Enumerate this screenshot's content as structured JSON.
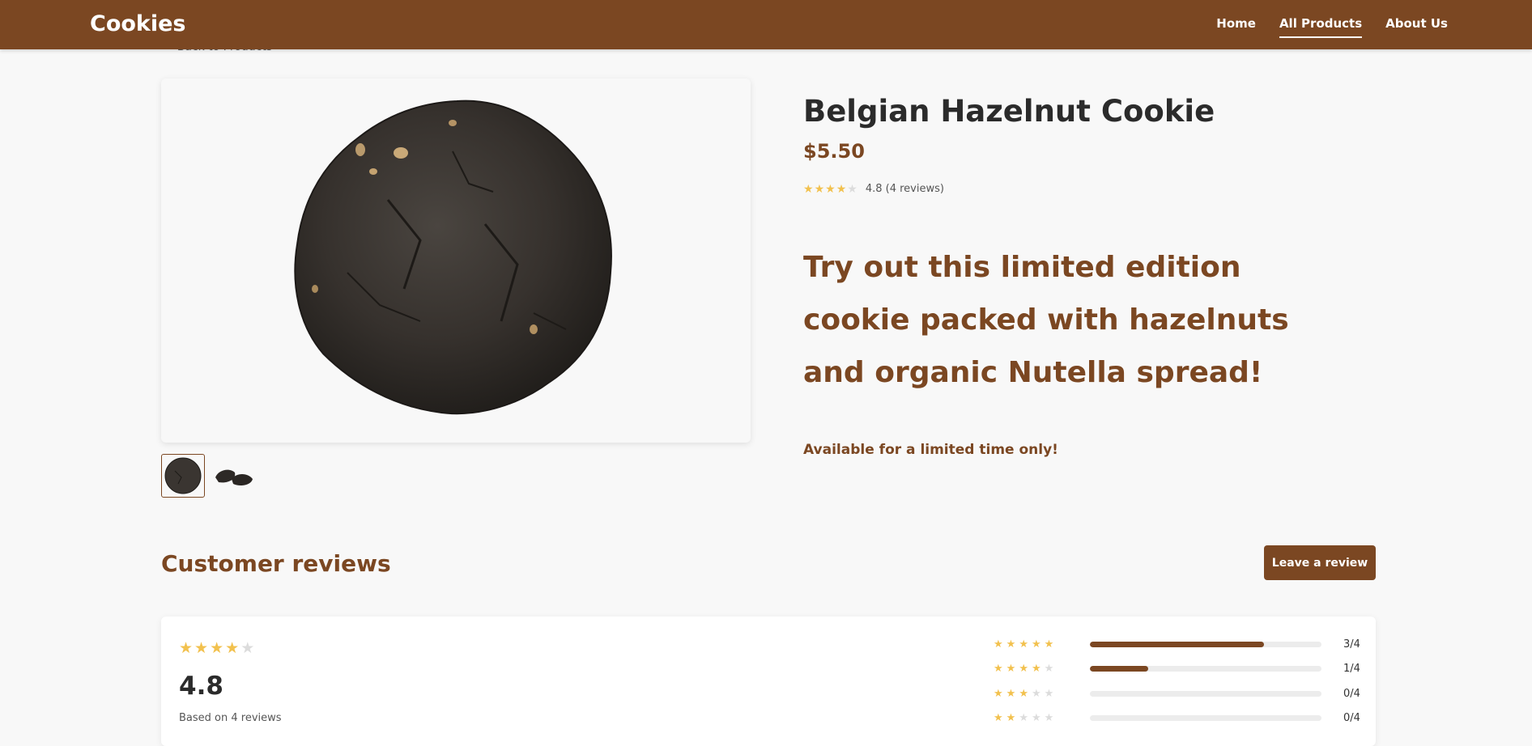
{
  "nav": {
    "brand": "Cookies",
    "links": [
      {
        "label": "Home",
        "active": false
      },
      {
        "label": "All Products",
        "active": true
      },
      {
        "label": "About Us",
        "active": false
      }
    ]
  },
  "back_link": {
    "label": "Back to Products",
    "icon": "arrow-left-icon"
  },
  "product": {
    "title": "Belgian Hazelnut Cookie",
    "price": "$5.50",
    "rating": 4.8,
    "rating_text": "4.8 (4 reviews)",
    "headline": "Try out this limited edition cookie packed with hazelnuts and organic Nutella spread!",
    "availability": "Available for a limited time only!",
    "images": [
      {
        "name": "cookie-whole",
        "active": true
      },
      {
        "name": "cookie-broken",
        "active": false
      }
    ]
  },
  "reviews": {
    "heading": "Customer reviews",
    "leave_review_label": "Leave a review",
    "average": "4.8",
    "average_stars": 4,
    "based_on": "Based on 4 reviews",
    "breakdown": [
      {
        "stars": 5,
        "count": 3,
        "total": 4,
        "label": "3/4"
      },
      {
        "stars": 4,
        "count": 1,
        "total": 4,
        "label": "1/4"
      },
      {
        "stars": 3,
        "count": 0,
        "total": 4,
        "label": "0/4"
      },
      {
        "stars": 2,
        "count": 0,
        "total": 4,
        "label": "0/4"
      }
    ]
  },
  "colors": {
    "brand": "#7b4722",
    "star": "#f2c14e",
    "star_off": "#dcdcdc",
    "background": "#f8f8f8"
  }
}
